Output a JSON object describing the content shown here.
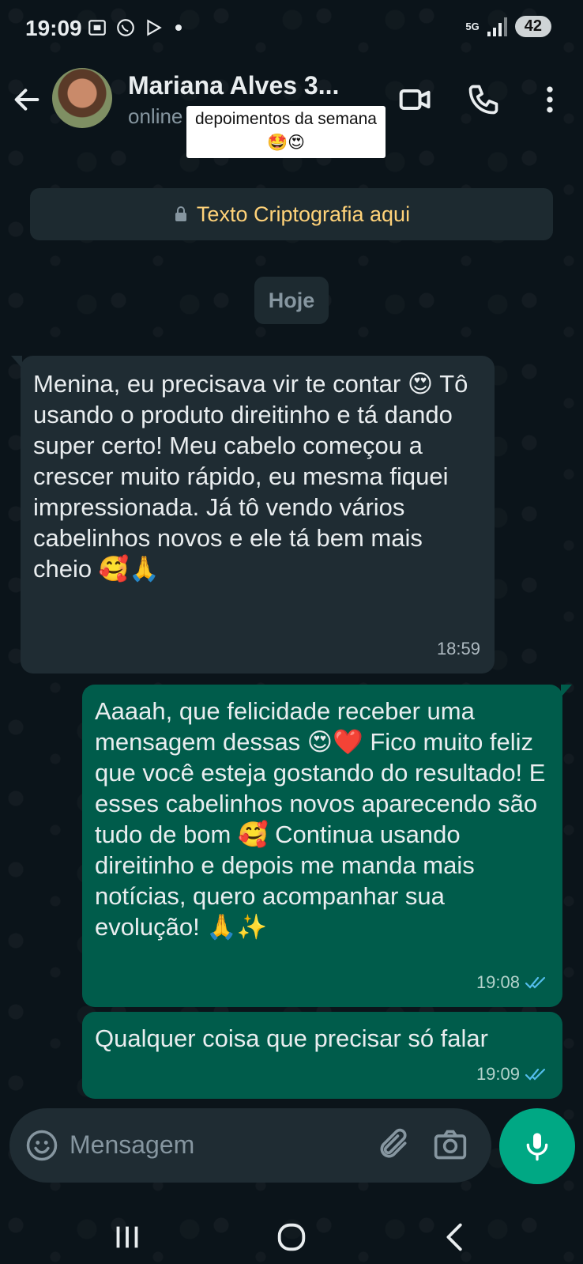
{
  "status_bar": {
    "time": "19:09",
    "network": "5G",
    "battery": "42"
  },
  "header": {
    "contact_name": "Mariana Alves 3...",
    "status": "online",
    "sticker_text": "depoimentos da semana🤩😍"
  },
  "encryption_notice": "Texto Criptografia aqui",
  "date_chip": "Hoje",
  "messages": [
    {
      "direction": "incoming",
      "text": "Menina, eu precisava vir te contar 😍 Tô usando o produto direitinho e tá dando super certo! Meu cabelo começou a crescer muito rápido, eu mesma fiquei impressionada. Já tô vendo vários cabelinhos novos e ele tá bem mais cheio 🥰🙏",
      "time": "18:59"
    },
    {
      "direction": "outgoing",
      "text": "Aaaah, que felicidade receber uma mensagem dessas 😍❤️ Fico muito feliz que você esteja gostando do resultado! E esses cabelinhos novos aparecendo são tudo de bom 🥰 Continua usando direitinho e depois me manda mais notícias, quero acompanhar sua evolução! 🙏✨",
      "time": "19:08",
      "read": true
    },
    {
      "direction": "outgoing",
      "text": "Qualquer coisa que precisar só falar",
      "time": "19:09",
      "read": true
    }
  ],
  "input": {
    "placeholder": "Mensagem"
  },
  "colors": {
    "background": "#0b141a",
    "incoming_bubble": "#1f2c33",
    "outgoing_bubble": "#005c4b",
    "accent": "#00a884",
    "read_ticks": "#53bdeb",
    "encryption_text": "#ffd279"
  },
  "icons": {
    "back": "arrow-left-icon",
    "video": "video-call-icon",
    "call": "phone-icon",
    "menu": "more-vert-icon",
    "lock": "lock-icon",
    "emoji": "emoji-icon",
    "attach": "paperclip-icon",
    "camera": "camera-icon",
    "mic": "mic-icon"
  }
}
